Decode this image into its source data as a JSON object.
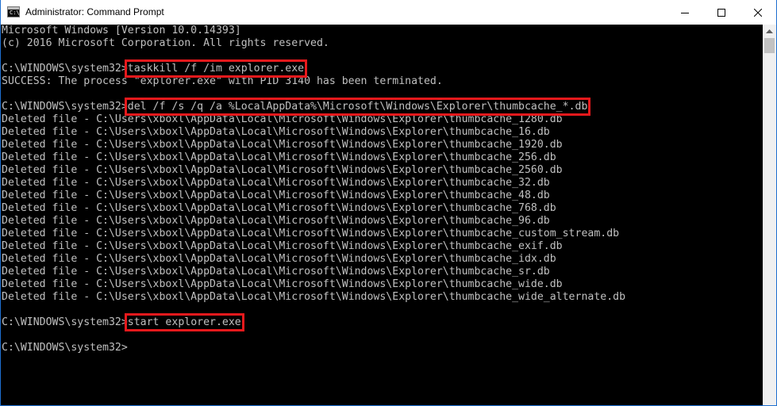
{
  "window": {
    "title": "Administrator: Command Prompt",
    "icon": "cmd-icon",
    "icon_glyph": "C:\\"
  },
  "controls": {
    "minimize": "minimize-icon",
    "maximize": "maximize-icon",
    "close": "close-icon"
  },
  "console": {
    "lines": [
      {
        "text": "Microsoft Windows [Version 10.0.14393]"
      },
      {
        "text": "(c) 2016 Microsoft Corporation. All rights reserved."
      },
      {
        "text": ""
      },
      {
        "prompt": "C:\\WINDOWS\\system32>",
        "command": "taskkill /f /im explorer.exe",
        "highlighted": true
      },
      {
        "text": "SUCCESS: The process \"explorer.exe\" with PID 3140 has been terminated."
      },
      {
        "text": ""
      },
      {
        "prompt": "C:\\WINDOWS\\system32>",
        "command": "del /f /s /q /a %LocalAppData%\\Microsoft\\Windows\\Explorer\\thumbcache_*.db",
        "highlighted": true
      },
      {
        "text": "Deleted file - C:\\Users\\xboxl\\AppData\\Local\\Microsoft\\Windows\\Explorer\\thumbcache_1280.db"
      },
      {
        "text": "Deleted file - C:\\Users\\xboxl\\AppData\\Local\\Microsoft\\Windows\\Explorer\\thumbcache_16.db"
      },
      {
        "text": "Deleted file - C:\\Users\\xboxl\\AppData\\Local\\Microsoft\\Windows\\Explorer\\thumbcache_1920.db"
      },
      {
        "text": "Deleted file - C:\\Users\\xboxl\\AppData\\Local\\Microsoft\\Windows\\Explorer\\thumbcache_256.db"
      },
      {
        "text": "Deleted file - C:\\Users\\xboxl\\AppData\\Local\\Microsoft\\Windows\\Explorer\\thumbcache_2560.db"
      },
      {
        "text": "Deleted file - C:\\Users\\xboxl\\AppData\\Local\\Microsoft\\Windows\\Explorer\\thumbcache_32.db"
      },
      {
        "text": "Deleted file - C:\\Users\\xboxl\\AppData\\Local\\Microsoft\\Windows\\Explorer\\thumbcache_48.db"
      },
      {
        "text": "Deleted file - C:\\Users\\xboxl\\AppData\\Local\\Microsoft\\Windows\\Explorer\\thumbcache_768.db"
      },
      {
        "text": "Deleted file - C:\\Users\\xboxl\\AppData\\Local\\Microsoft\\Windows\\Explorer\\thumbcache_96.db"
      },
      {
        "text": "Deleted file - C:\\Users\\xboxl\\AppData\\Local\\Microsoft\\Windows\\Explorer\\thumbcache_custom_stream.db"
      },
      {
        "text": "Deleted file - C:\\Users\\xboxl\\AppData\\Local\\Microsoft\\Windows\\Explorer\\thumbcache_exif.db"
      },
      {
        "text": "Deleted file - C:\\Users\\xboxl\\AppData\\Local\\Microsoft\\Windows\\Explorer\\thumbcache_idx.db"
      },
      {
        "text": "Deleted file - C:\\Users\\xboxl\\AppData\\Local\\Microsoft\\Windows\\Explorer\\thumbcache_sr.db"
      },
      {
        "text": "Deleted file - C:\\Users\\xboxl\\AppData\\Local\\Microsoft\\Windows\\Explorer\\thumbcache_wide.db"
      },
      {
        "text": "Deleted file - C:\\Users\\xboxl\\AppData\\Local\\Microsoft\\Windows\\Explorer\\thumbcache_wide_alternate.db"
      },
      {
        "text": ""
      },
      {
        "prompt": "C:\\WINDOWS\\system32>",
        "command": "start explorer.exe",
        "highlighted": true
      },
      {
        "text": ""
      },
      {
        "prompt": "C:\\WINDOWS\\system32>",
        "command": "",
        "highlighted": false
      }
    ]
  },
  "scrollbar": {
    "up_icon": "scroll-up-icon"
  },
  "colors": {
    "console_bg": "#000000",
    "console_text": "#c0c0c0",
    "highlight": "#e8191c",
    "window_border": "#1e6fd0"
  }
}
